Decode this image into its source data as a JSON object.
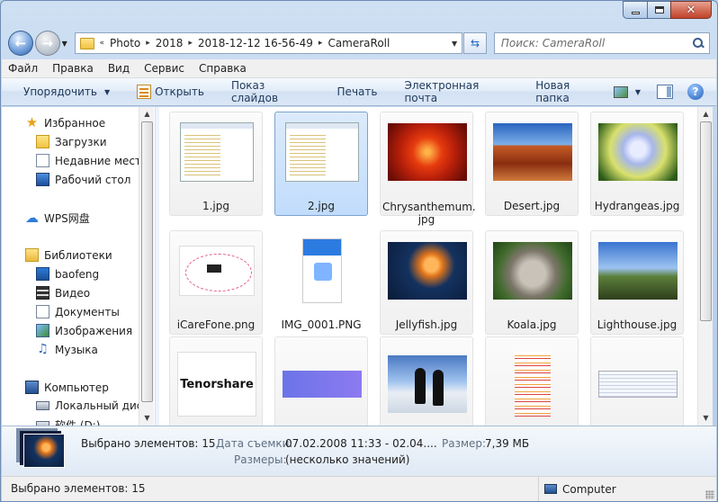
{
  "nav": {
    "path": [
      "Photo",
      "2018",
      "2018-12-12 16-56-49",
      "CameraRoll"
    ],
    "overflow": "«",
    "search_placeholder": "Поиск: CameraRoll"
  },
  "menu": [
    "Файл",
    "Правка",
    "Вид",
    "Сервис",
    "Справка"
  ],
  "toolbar": {
    "organize": "Упорядочить",
    "open": "Открыть",
    "slideshow": "Показ слайдов",
    "print": "Печать",
    "email": "Электронная почта",
    "new_folder": "Новая папка"
  },
  "sidebar": {
    "favorites": "Избранное",
    "downloads": "Загрузки",
    "recent": "Недавние места",
    "desktop": "Рабочий стол",
    "wps": "WPS网盘",
    "libraries": "Библиотеки",
    "baofeng": "baofeng",
    "video": "Видео",
    "documents": "Документы",
    "images": "Изображения",
    "music": "Музыка",
    "computer": "Компьютер",
    "local_disk": "Локальный диск",
    "drive_d": "软件 (D:)"
  },
  "files": [
    {
      "name": "1.jpg"
    },
    {
      "name": "2.jpg"
    },
    {
      "name": "Chrysanthemum.\njpg"
    },
    {
      "name": "Desert.jpg"
    },
    {
      "name": "Hydrangeas.jpg"
    },
    {
      "name": "iCareFone.png"
    },
    {
      "name": "IMG_0001.PNG"
    },
    {
      "name": "Jellyfish.jpg"
    },
    {
      "name": "Koala.jpg"
    },
    {
      "name": "Lighthouse.jpg"
    }
  ],
  "thumb_text": {
    "tenorshare": "Tenorshare"
  },
  "details": {
    "selected": "Выбрано элементов: 15",
    "date_label": "Дата съемки:",
    "date_value": "07.02.2008 11:33 - 02.04....",
    "size_label": "Размер:",
    "size_value": "7,39 МБ",
    "dims_label": "Размеры:",
    "dims_value": "(несколько значений)"
  },
  "status": {
    "left": "Выбрано элементов: 15",
    "right": "Computer"
  }
}
